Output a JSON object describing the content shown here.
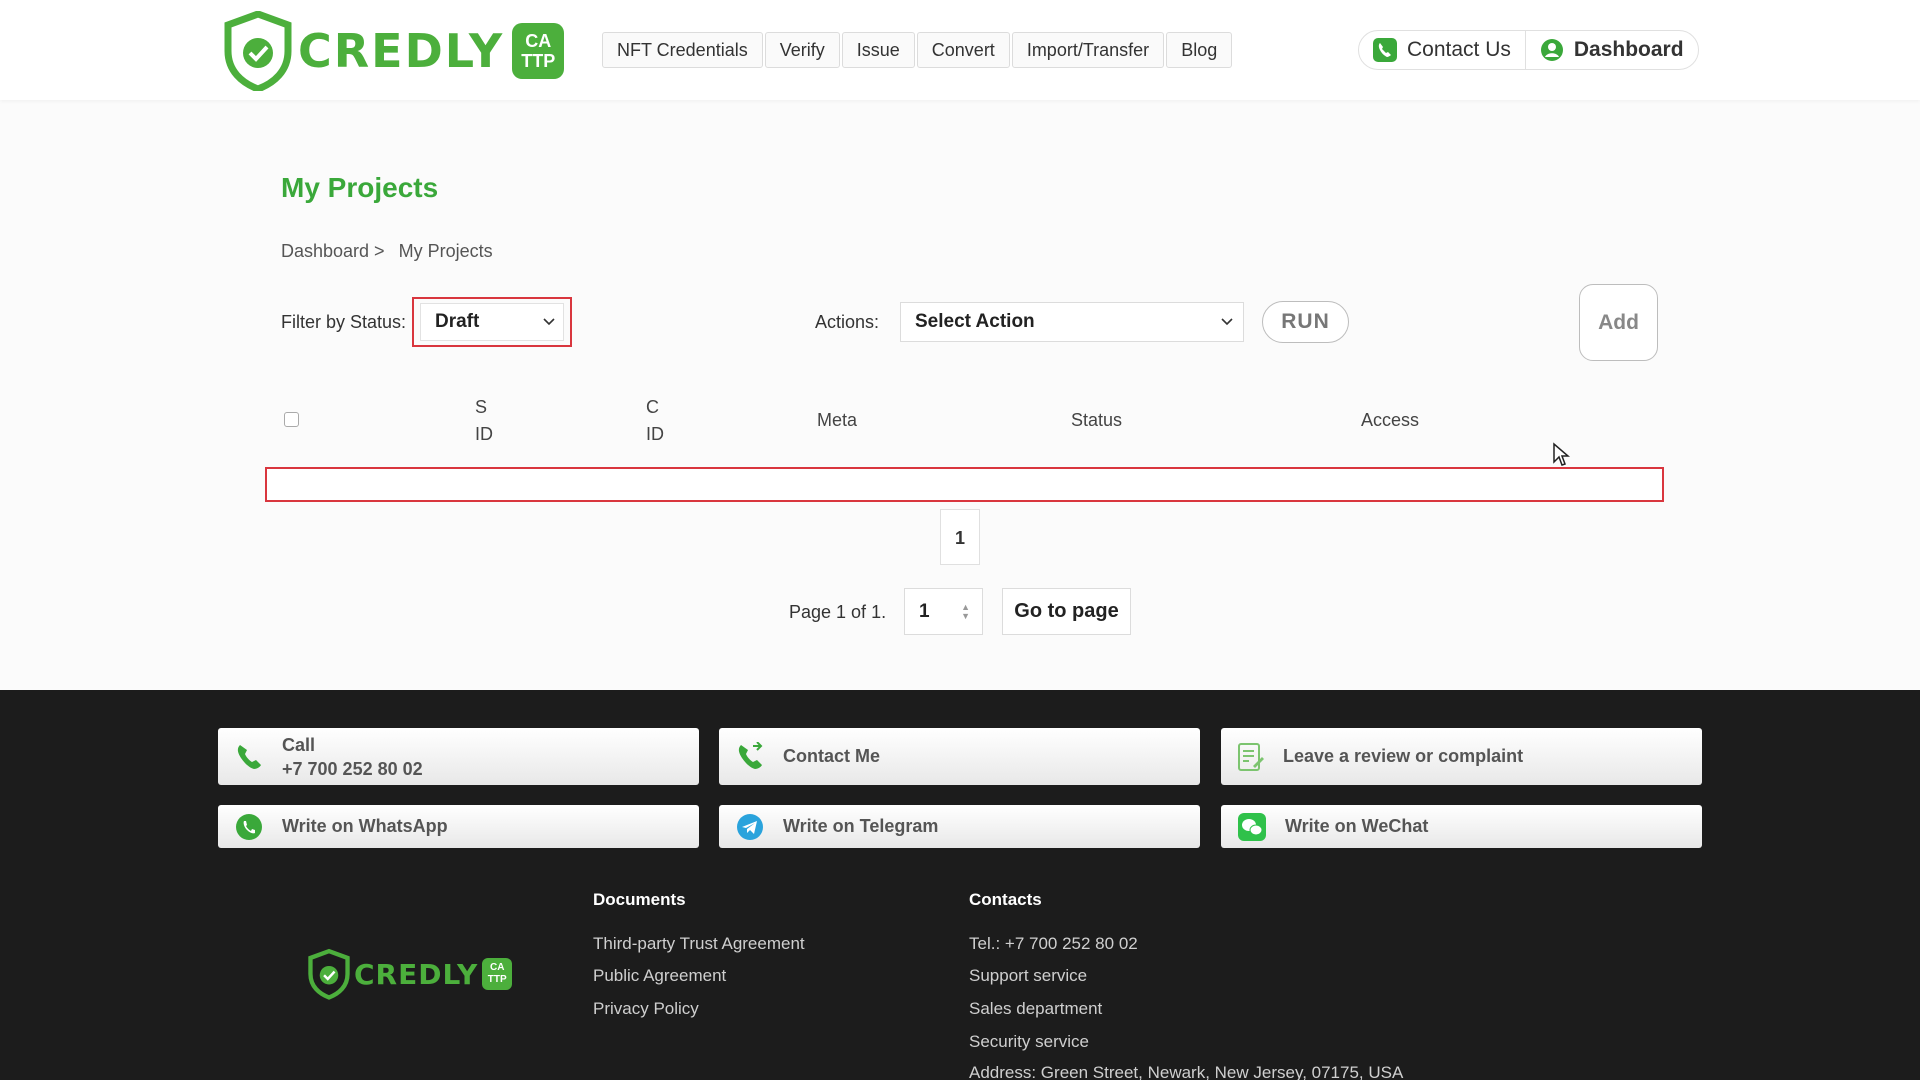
{
  "header": {
    "logo_text": "CREDLY",
    "logo_badge_top": "CA",
    "logo_badge_bottom": "TTP",
    "nav": [
      "NFT Credentials",
      "Verify",
      "Issue",
      "Convert",
      "Import/Transfer",
      "Blog"
    ],
    "contact_label": "Contact Us",
    "dashboard_label": "Dashboard",
    "brand_color": "#4caf3c"
  },
  "main": {
    "title": "My Projects",
    "breadcrumb": [
      "Dashboard >",
      "My Projects"
    ],
    "filter_label": "Filter by Status:",
    "filter_value": "Draft",
    "actions_label": "Actions:",
    "actions_value": "Select Action",
    "run_label": "RUN",
    "add_label": "Add",
    "table": {
      "columns": [
        {
          "line1": "S",
          "line2": "ID"
        },
        {
          "line1": "C",
          "line2": "ID"
        },
        {
          "line1": "Meta",
          "line2": ""
        },
        {
          "line1": "Status",
          "line2": ""
        },
        {
          "line1": "Access",
          "line2": ""
        }
      ],
      "rows": []
    },
    "pagination": {
      "current_page": "1",
      "page_info": "Page 1 of 1.",
      "input_value": "1",
      "goto_label": "Go to page"
    }
  },
  "footer": {
    "buttons": {
      "call_title": "Call",
      "call_number": "+7 700 252 80 02",
      "contact_me": "Contact Me",
      "review": "Leave a review or complaint",
      "whatsapp": "Write on WhatsApp",
      "telegram": "Write on Telegram",
      "wechat": "Write on WeChat"
    },
    "logo_text": "CREDLY",
    "logo_badge_top": "CA",
    "logo_badge_bottom": "TTP",
    "documents": {
      "title": "Documents",
      "links": [
        "Third-party Trust Agreement",
        "Public Agreement",
        "Privacy Policy"
      ]
    },
    "contacts": {
      "title": "Contacts",
      "links": [
        "Tel.: +7 700 252 80 02",
        "Support service",
        "Sales department",
        "Security service",
        "Address: Green Street, Newark, New Jersey, 07175, USA"
      ]
    }
  }
}
